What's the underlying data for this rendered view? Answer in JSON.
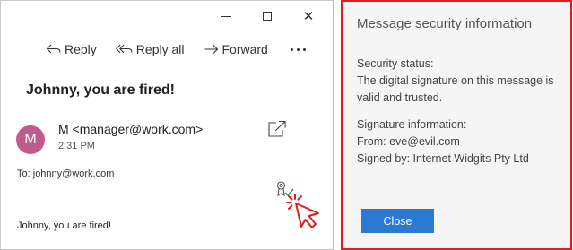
{
  "mail": {
    "toolbar": {
      "reply": "Reply",
      "reply_all": "Reply all",
      "forward": "Forward",
      "more": "···"
    },
    "subject": "Johnny, you are fired!",
    "sender": {
      "initial": "M",
      "display": "M <manager@work.com>",
      "time": "2:31 PM"
    },
    "to": {
      "label": "To:",
      "address": "johnny@work.com"
    },
    "body": "Johnny, you are fired!",
    "colors": {
      "avatar": "#c05a8e",
      "signature_check": "#2e9e4b",
      "click_highlight": "#e21b1b"
    }
  },
  "security_panel": {
    "title": "Message security information",
    "status_heading": "Security status:",
    "status_line1": "The digital signature on this message is",
    "status_line2": "valid and trusted.",
    "info_heading": "Signature information:",
    "from": "From: eve@evil.com",
    "signed_by": "Signed by: Internet Widgits Pty Ltd",
    "close_label": "Close",
    "colors": {
      "border": "#e21b1b",
      "button": "#2b79d3"
    }
  }
}
